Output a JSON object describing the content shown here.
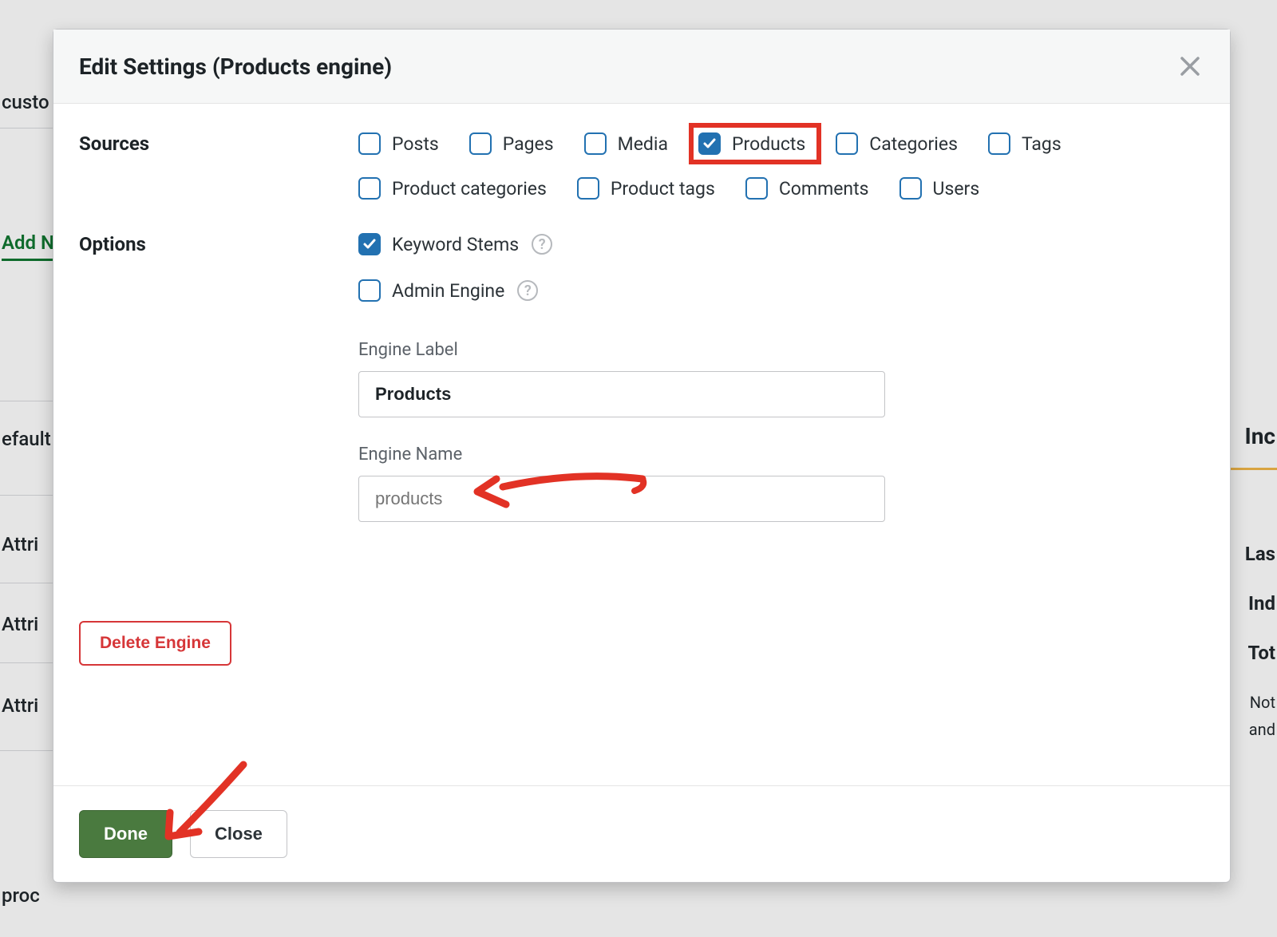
{
  "background": {
    "custo": "custo",
    "addNew": "Add N",
    "efault": "efault",
    "attri1": "Attri",
    "attri2": "Attri",
    "attri3": "Attri",
    "proc": "proc",
    "inc": "Inc",
    "las": "Las",
    "ind": "Ind",
    "tot": "Tot",
    "not": "Not",
    "and": "and"
  },
  "modal": {
    "title": "Edit Settings (Products engine)"
  },
  "sections": {
    "sources": "Sources",
    "options": "Options"
  },
  "sources": [
    {
      "id": "posts",
      "label": "Posts",
      "checked": false
    },
    {
      "id": "pages",
      "label": "Pages",
      "checked": false
    },
    {
      "id": "media",
      "label": "Media",
      "checked": false
    },
    {
      "id": "products",
      "label": "Products",
      "checked": true,
      "highlight": true
    },
    {
      "id": "categories",
      "label": "Categories",
      "checked": false
    },
    {
      "id": "tags",
      "label": "Tags",
      "checked": false
    },
    {
      "id": "product-categories",
      "label": "Product categories",
      "checked": false
    },
    {
      "id": "product-tags",
      "label": "Product tags",
      "checked": false
    },
    {
      "id": "comments",
      "label": "Comments",
      "checked": false
    },
    {
      "id": "users",
      "label": "Users",
      "checked": false
    }
  ],
  "options": {
    "keywordStems": {
      "label": "Keyword Stems",
      "checked": true,
      "help": true
    },
    "adminEngine": {
      "label": "Admin Engine",
      "checked": false,
      "help": true
    },
    "engineLabel": {
      "label": "Engine Label",
      "value": "Products"
    },
    "engineName": {
      "label": "Engine Name",
      "placeholder": "products"
    }
  },
  "buttons": {
    "delete": "Delete Engine",
    "done": "Done",
    "close": "Close"
  }
}
